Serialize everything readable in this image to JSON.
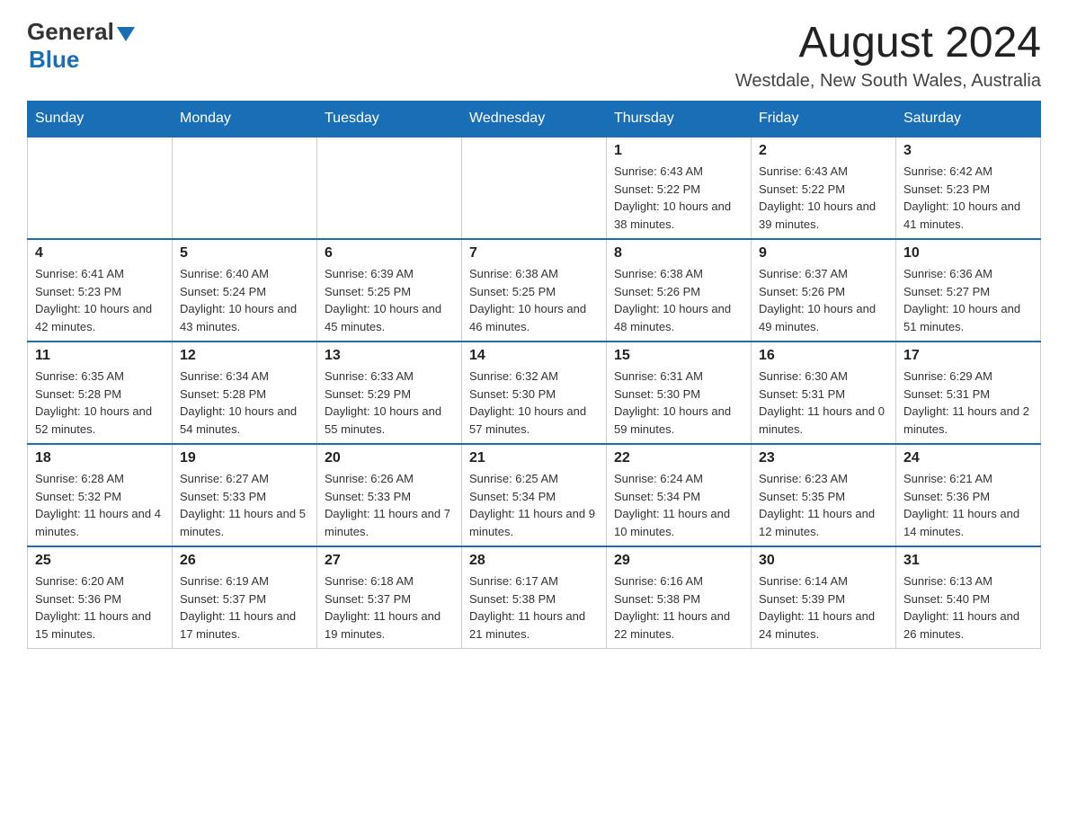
{
  "header": {
    "logo_general": "General",
    "logo_blue": "Blue",
    "month_title": "August 2024",
    "location": "Westdale, New South Wales, Australia"
  },
  "days_of_week": [
    "Sunday",
    "Monday",
    "Tuesday",
    "Wednesday",
    "Thursday",
    "Friday",
    "Saturday"
  ],
  "weeks": [
    [
      {
        "day": "",
        "info": ""
      },
      {
        "day": "",
        "info": ""
      },
      {
        "day": "",
        "info": ""
      },
      {
        "day": "",
        "info": ""
      },
      {
        "day": "1",
        "info": "Sunrise: 6:43 AM\nSunset: 5:22 PM\nDaylight: 10 hours and 38 minutes."
      },
      {
        "day": "2",
        "info": "Sunrise: 6:43 AM\nSunset: 5:22 PM\nDaylight: 10 hours and 39 minutes."
      },
      {
        "day": "3",
        "info": "Sunrise: 6:42 AM\nSunset: 5:23 PM\nDaylight: 10 hours and 41 minutes."
      }
    ],
    [
      {
        "day": "4",
        "info": "Sunrise: 6:41 AM\nSunset: 5:23 PM\nDaylight: 10 hours and 42 minutes."
      },
      {
        "day": "5",
        "info": "Sunrise: 6:40 AM\nSunset: 5:24 PM\nDaylight: 10 hours and 43 minutes."
      },
      {
        "day": "6",
        "info": "Sunrise: 6:39 AM\nSunset: 5:25 PM\nDaylight: 10 hours and 45 minutes."
      },
      {
        "day": "7",
        "info": "Sunrise: 6:38 AM\nSunset: 5:25 PM\nDaylight: 10 hours and 46 minutes."
      },
      {
        "day": "8",
        "info": "Sunrise: 6:38 AM\nSunset: 5:26 PM\nDaylight: 10 hours and 48 minutes."
      },
      {
        "day": "9",
        "info": "Sunrise: 6:37 AM\nSunset: 5:26 PM\nDaylight: 10 hours and 49 minutes."
      },
      {
        "day": "10",
        "info": "Sunrise: 6:36 AM\nSunset: 5:27 PM\nDaylight: 10 hours and 51 minutes."
      }
    ],
    [
      {
        "day": "11",
        "info": "Sunrise: 6:35 AM\nSunset: 5:28 PM\nDaylight: 10 hours and 52 minutes."
      },
      {
        "day": "12",
        "info": "Sunrise: 6:34 AM\nSunset: 5:28 PM\nDaylight: 10 hours and 54 minutes."
      },
      {
        "day": "13",
        "info": "Sunrise: 6:33 AM\nSunset: 5:29 PM\nDaylight: 10 hours and 55 minutes."
      },
      {
        "day": "14",
        "info": "Sunrise: 6:32 AM\nSunset: 5:30 PM\nDaylight: 10 hours and 57 minutes."
      },
      {
        "day": "15",
        "info": "Sunrise: 6:31 AM\nSunset: 5:30 PM\nDaylight: 10 hours and 59 minutes."
      },
      {
        "day": "16",
        "info": "Sunrise: 6:30 AM\nSunset: 5:31 PM\nDaylight: 11 hours and 0 minutes."
      },
      {
        "day": "17",
        "info": "Sunrise: 6:29 AM\nSunset: 5:31 PM\nDaylight: 11 hours and 2 minutes."
      }
    ],
    [
      {
        "day": "18",
        "info": "Sunrise: 6:28 AM\nSunset: 5:32 PM\nDaylight: 11 hours and 4 minutes."
      },
      {
        "day": "19",
        "info": "Sunrise: 6:27 AM\nSunset: 5:33 PM\nDaylight: 11 hours and 5 minutes."
      },
      {
        "day": "20",
        "info": "Sunrise: 6:26 AM\nSunset: 5:33 PM\nDaylight: 11 hours and 7 minutes."
      },
      {
        "day": "21",
        "info": "Sunrise: 6:25 AM\nSunset: 5:34 PM\nDaylight: 11 hours and 9 minutes."
      },
      {
        "day": "22",
        "info": "Sunrise: 6:24 AM\nSunset: 5:34 PM\nDaylight: 11 hours and 10 minutes."
      },
      {
        "day": "23",
        "info": "Sunrise: 6:23 AM\nSunset: 5:35 PM\nDaylight: 11 hours and 12 minutes."
      },
      {
        "day": "24",
        "info": "Sunrise: 6:21 AM\nSunset: 5:36 PM\nDaylight: 11 hours and 14 minutes."
      }
    ],
    [
      {
        "day": "25",
        "info": "Sunrise: 6:20 AM\nSunset: 5:36 PM\nDaylight: 11 hours and 15 minutes."
      },
      {
        "day": "26",
        "info": "Sunrise: 6:19 AM\nSunset: 5:37 PM\nDaylight: 11 hours and 17 minutes."
      },
      {
        "day": "27",
        "info": "Sunrise: 6:18 AM\nSunset: 5:37 PM\nDaylight: 11 hours and 19 minutes."
      },
      {
        "day": "28",
        "info": "Sunrise: 6:17 AM\nSunset: 5:38 PM\nDaylight: 11 hours and 21 minutes."
      },
      {
        "day": "29",
        "info": "Sunrise: 6:16 AM\nSunset: 5:38 PM\nDaylight: 11 hours and 22 minutes."
      },
      {
        "day": "30",
        "info": "Sunrise: 6:14 AM\nSunset: 5:39 PM\nDaylight: 11 hours and 24 minutes."
      },
      {
        "day": "31",
        "info": "Sunrise: 6:13 AM\nSunset: 5:40 PM\nDaylight: 11 hours and 26 minutes."
      }
    ]
  ]
}
